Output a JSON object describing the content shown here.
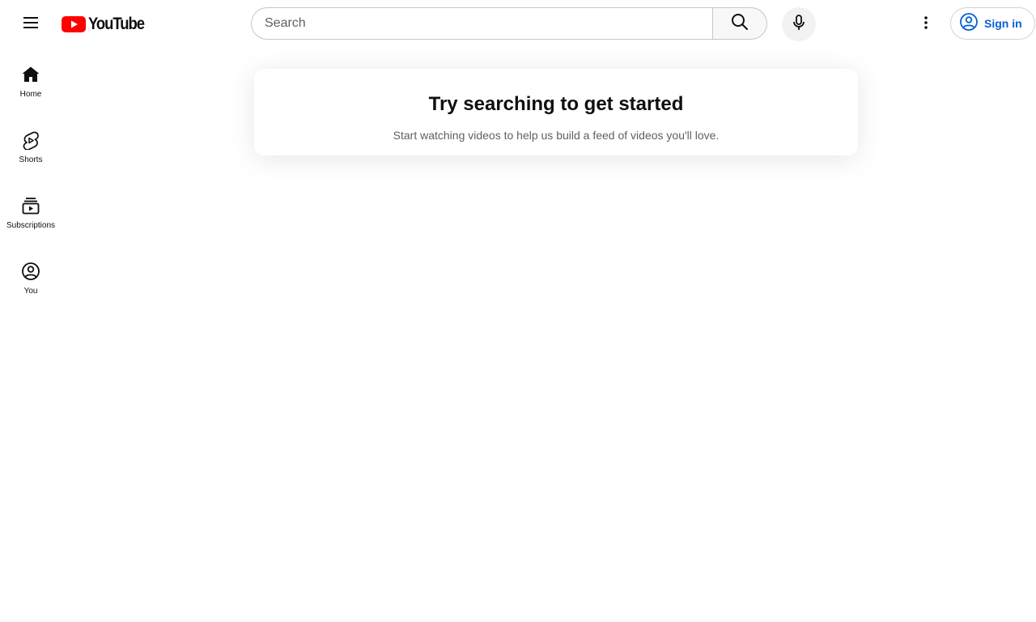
{
  "masthead": {
    "menu_icon": "hamburger-menu-icon",
    "logo_text": "YouTube",
    "logo_color": "#ff0000",
    "search": {
      "placeholder": "Search",
      "value": "",
      "button_icon": "search-icon"
    },
    "voice_search_icon": "microphone-icon",
    "more_icon": "vertical-dots-icon",
    "sign_in": {
      "label": "Sign in",
      "icon": "account-circle-icon",
      "color": "#065fd4"
    }
  },
  "guide": {
    "items": [
      {
        "label": "Home",
        "icon": "home-icon"
      },
      {
        "label": "Shorts",
        "icon": "shorts-icon"
      },
      {
        "label": "Subscriptions",
        "icon": "subscriptions-icon"
      },
      {
        "label": "You",
        "icon": "account-circle-icon"
      }
    ]
  },
  "main": {
    "prompt": {
      "title": "Try searching to get started",
      "subtitle": "Start watching videos to help us build a feed of videos you'll love."
    }
  }
}
